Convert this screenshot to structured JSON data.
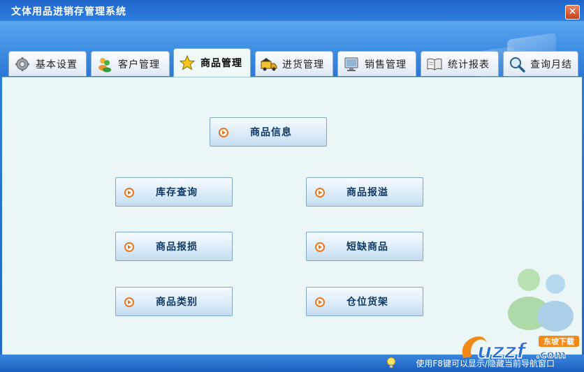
{
  "window": {
    "title": "文体用品进销存管理系统"
  },
  "tabs": [
    {
      "label": "基本设置",
      "icon": "gear-icon"
    },
    {
      "label": "客户管理",
      "icon": "users-icon"
    },
    {
      "label": "商品管理",
      "icon": "star-icon",
      "active": true
    },
    {
      "label": "进货管理",
      "icon": "truck-icon"
    },
    {
      "label": "销售管理",
      "icon": "monitor-icon"
    },
    {
      "label": "统计报表",
      "icon": "book-icon"
    },
    {
      "label": "查询月结",
      "icon": "magnifier-icon"
    }
  ],
  "buttons": {
    "product_info": "商品信息",
    "stock_query": "库存查询",
    "product_overflow": "商品报溢",
    "product_damage": "商品报损",
    "short_products": "短缺商品",
    "product_category": "商品类别",
    "warehouse_shelf": "仓位货架"
  },
  "status": {
    "hint": "使用F8键可以显示/隐藏当前导航窗口"
  },
  "watermark": {
    "brand": "uzzf",
    "suffix": ".com",
    "badge": "东坡下载"
  },
  "colors": {
    "accent": "#2d7fdc",
    "content_bg": "#eaf7f6",
    "button_text": "#0f3a66",
    "arrow": "#e8771f"
  }
}
